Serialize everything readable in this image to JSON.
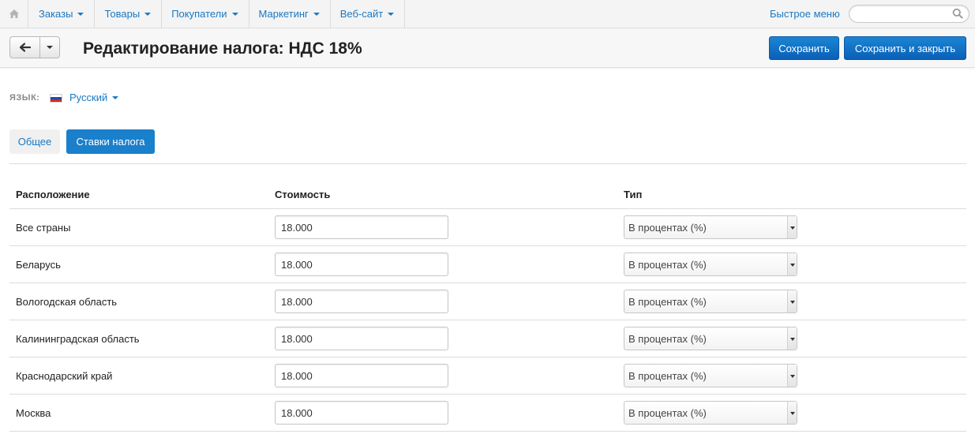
{
  "nav": {
    "home_icon": "home-icon",
    "items": [
      {
        "label": "Заказы"
      },
      {
        "label": "Товары"
      },
      {
        "label": "Покупатели"
      },
      {
        "label": "Маркетинг"
      },
      {
        "label": "Веб-сайт"
      }
    ],
    "quick_menu": "Быстрое меню",
    "search": {
      "value": "",
      "placeholder": ""
    }
  },
  "toolbar": {
    "title": "Редактирование налога: НДС 18%",
    "save_label": "Сохранить",
    "save_close_label": "Сохранить и закрыть"
  },
  "language": {
    "label": "ЯЗЫК:",
    "selected": "Русский",
    "flag_icon": "russia-flag-icon"
  },
  "tabs": [
    {
      "label": "Общее",
      "active": false
    },
    {
      "label": "Ставки налога",
      "active": true
    }
  ],
  "table": {
    "columns": [
      "Расположение",
      "Стоимость",
      "Тип"
    ],
    "rows": [
      {
        "location": "Все страны",
        "cost": "18.000",
        "type": "В процентах (%)"
      },
      {
        "location": "Беларусь",
        "cost": "18.000",
        "type": "В процентах (%)"
      },
      {
        "location": "Вологодская область",
        "cost": "18.000",
        "type": "В процентах (%)"
      },
      {
        "location": "Калининградская область",
        "cost": "18.000",
        "type": "В процентах (%)"
      },
      {
        "location": "Краснодарский край",
        "cost": "18.000",
        "type": "В процентах (%)"
      },
      {
        "location": "Москва",
        "cost": "18.000",
        "type": "В процентах (%)"
      }
    ]
  },
  "colors": {
    "accent": "#1a78c2",
    "primary_button": "#0e6fc4",
    "active_tab": "#1a80cc"
  }
}
